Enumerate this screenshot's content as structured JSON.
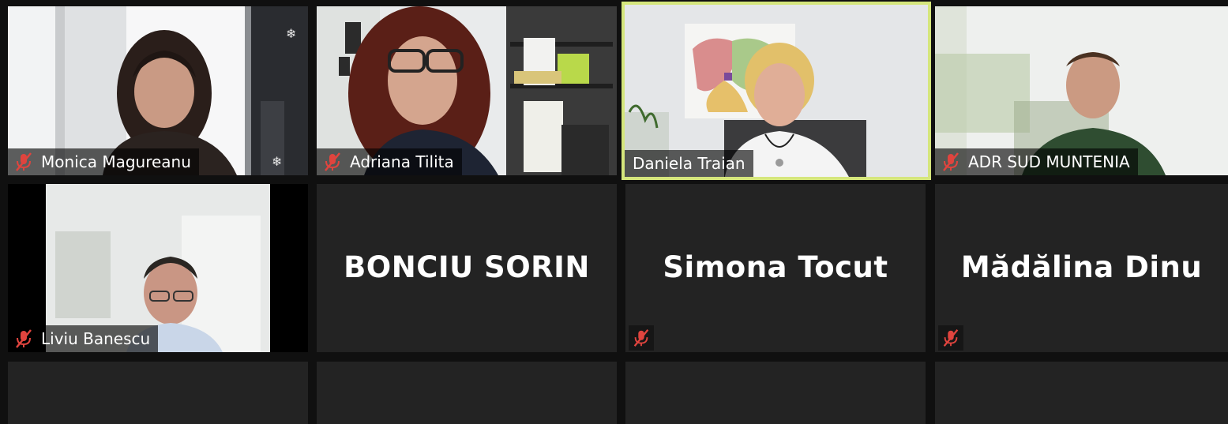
{
  "meeting": {
    "view": "gallery",
    "accent_speaking": "#d5e67c",
    "tile_bg": "#232323",
    "mic_muted_color": "#e0443e"
  },
  "participants": [
    {
      "name": "Monica Magureanu",
      "video": true,
      "muted": true
    },
    {
      "name": "Adriana Tilita",
      "video": true,
      "muted": true
    },
    {
      "name": "Daniela Traian",
      "video": true,
      "muted": false,
      "active_speaker": true
    },
    {
      "name": "ADR SUD MUNTENIA",
      "video": true,
      "muted": true
    },
    {
      "name": "Liviu Banescu",
      "video": true,
      "muted": true
    },
    {
      "name": "BONCIU SORIN",
      "video": false,
      "muted": false
    },
    {
      "name": "Simona Tocut",
      "video": false,
      "muted": true
    },
    {
      "name": "Mădălina Dinu",
      "video": false,
      "muted": true
    }
  ]
}
